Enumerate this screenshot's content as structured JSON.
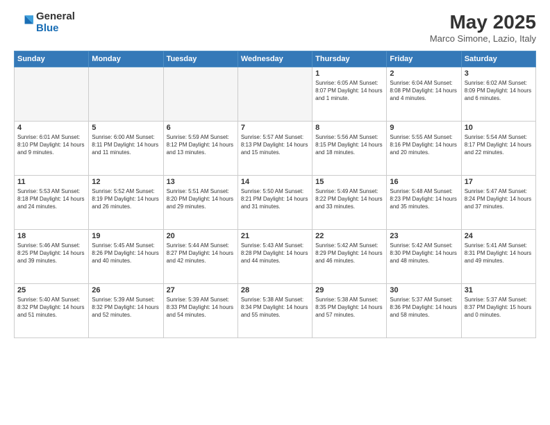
{
  "logo": {
    "general": "General",
    "blue": "Blue"
  },
  "title": "May 2025",
  "subtitle": "Marco Simone, Lazio, Italy",
  "days_of_week": [
    "Sunday",
    "Monday",
    "Tuesday",
    "Wednesday",
    "Thursday",
    "Friday",
    "Saturday"
  ],
  "weeks": [
    [
      {
        "num": "",
        "info": "",
        "empty": true
      },
      {
        "num": "",
        "info": "",
        "empty": true
      },
      {
        "num": "",
        "info": "",
        "empty": true
      },
      {
        "num": "",
        "info": "",
        "empty": true
      },
      {
        "num": "1",
        "info": "Sunrise: 6:05 AM\nSunset: 8:07 PM\nDaylight: 14 hours\nand 1 minute.",
        "empty": false
      },
      {
        "num": "2",
        "info": "Sunrise: 6:04 AM\nSunset: 8:08 PM\nDaylight: 14 hours\nand 4 minutes.",
        "empty": false
      },
      {
        "num": "3",
        "info": "Sunrise: 6:02 AM\nSunset: 8:09 PM\nDaylight: 14 hours\nand 6 minutes.",
        "empty": false
      }
    ],
    [
      {
        "num": "4",
        "info": "Sunrise: 6:01 AM\nSunset: 8:10 PM\nDaylight: 14 hours\nand 9 minutes.",
        "empty": false
      },
      {
        "num": "5",
        "info": "Sunrise: 6:00 AM\nSunset: 8:11 PM\nDaylight: 14 hours\nand 11 minutes.",
        "empty": false
      },
      {
        "num": "6",
        "info": "Sunrise: 5:59 AM\nSunset: 8:12 PM\nDaylight: 14 hours\nand 13 minutes.",
        "empty": false
      },
      {
        "num": "7",
        "info": "Sunrise: 5:57 AM\nSunset: 8:13 PM\nDaylight: 14 hours\nand 15 minutes.",
        "empty": false
      },
      {
        "num": "8",
        "info": "Sunrise: 5:56 AM\nSunset: 8:15 PM\nDaylight: 14 hours\nand 18 minutes.",
        "empty": false
      },
      {
        "num": "9",
        "info": "Sunrise: 5:55 AM\nSunset: 8:16 PM\nDaylight: 14 hours\nand 20 minutes.",
        "empty": false
      },
      {
        "num": "10",
        "info": "Sunrise: 5:54 AM\nSunset: 8:17 PM\nDaylight: 14 hours\nand 22 minutes.",
        "empty": false
      }
    ],
    [
      {
        "num": "11",
        "info": "Sunrise: 5:53 AM\nSunset: 8:18 PM\nDaylight: 14 hours\nand 24 minutes.",
        "empty": false
      },
      {
        "num": "12",
        "info": "Sunrise: 5:52 AM\nSunset: 8:19 PM\nDaylight: 14 hours\nand 26 minutes.",
        "empty": false
      },
      {
        "num": "13",
        "info": "Sunrise: 5:51 AM\nSunset: 8:20 PM\nDaylight: 14 hours\nand 29 minutes.",
        "empty": false
      },
      {
        "num": "14",
        "info": "Sunrise: 5:50 AM\nSunset: 8:21 PM\nDaylight: 14 hours\nand 31 minutes.",
        "empty": false
      },
      {
        "num": "15",
        "info": "Sunrise: 5:49 AM\nSunset: 8:22 PM\nDaylight: 14 hours\nand 33 minutes.",
        "empty": false
      },
      {
        "num": "16",
        "info": "Sunrise: 5:48 AM\nSunset: 8:23 PM\nDaylight: 14 hours\nand 35 minutes.",
        "empty": false
      },
      {
        "num": "17",
        "info": "Sunrise: 5:47 AM\nSunset: 8:24 PM\nDaylight: 14 hours\nand 37 minutes.",
        "empty": false
      }
    ],
    [
      {
        "num": "18",
        "info": "Sunrise: 5:46 AM\nSunset: 8:25 PM\nDaylight: 14 hours\nand 39 minutes.",
        "empty": false
      },
      {
        "num": "19",
        "info": "Sunrise: 5:45 AM\nSunset: 8:26 PM\nDaylight: 14 hours\nand 40 minutes.",
        "empty": false
      },
      {
        "num": "20",
        "info": "Sunrise: 5:44 AM\nSunset: 8:27 PM\nDaylight: 14 hours\nand 42 minutes.",
        "empty": false
      },
      {
        "num": "21",
        "info": "Sunrise: 5:43 AM\nSunset: 8:28 PM\nDaylight: 14 hours\nand 44 minutes.",
        "empty": false
      },
      {
        "num": "22",
        "info": "Sunrise: 5:42 AM\nSunset: 8:29 PM\nDaylight: 14 hours\nand 46 minutes.",
        "empty": false
      },
      {
        "num": "23",
        "info": "Sunrise: 5:42 AM\nSunset: 8:30 PM\nDaylight: 14 hours\nand 48 minutes.",
        "empty": false
      },
      {
        "num": "24",
        "info": "Sunrise: 5:41 AM\nSunset: 8:31 PM\nDaylight: 14 hours\nand 49 minutes.",
        "empty": false
      }
    ],
    [
      {
        "num": "25",
        "info": "Sunrise: 5:40 AM\nSunset: 8:32 PM\nDaylight: 14 hours\nand 51 minutes.",
        "empty": false
      },
      {
        "num": "26",
        "info": "Sunrise: 5:39 AM\nSunset: 8:32 PM\nDaylight: 14 hours\nand 52 minutes.",
        "empty": false
      },
      {
        "num": "27",
        "info": "Sunrise: 5:39 AM\nSunset: 8:33 PM\nDaylight: 14 hours\nand 54 minutes.",
        "empty": false
      },
      {
        "num": "28",
        "info": "Sunrise: 5:38 AM\nSunset: 8:34 PM\nDaylight: 14 hours\nand 55 minutes.",
        "empty": false
      },
      {
        "num": "29",
        "info": "Sunrise: 5:38 AM\nSunset: 8:35 PM\nDaylight: 14 hours\nand 57 minutes.",
        "empty": false
      },
      {
        "num": "30",
        "info": "Sunrise: 5:37 AM\nSunset: 8:36 PM\nDaylight: 14 hours\nand 58 minutes.",
        "empty": false
      },
      {
        "num": "31",
        "info": "Sunrise: 5:37 AM\nSunset: 8:37 PM\nDaylight: 15 hours\nand 0 minutes.",
        "empty": false
      }
    ]
  ]
}
